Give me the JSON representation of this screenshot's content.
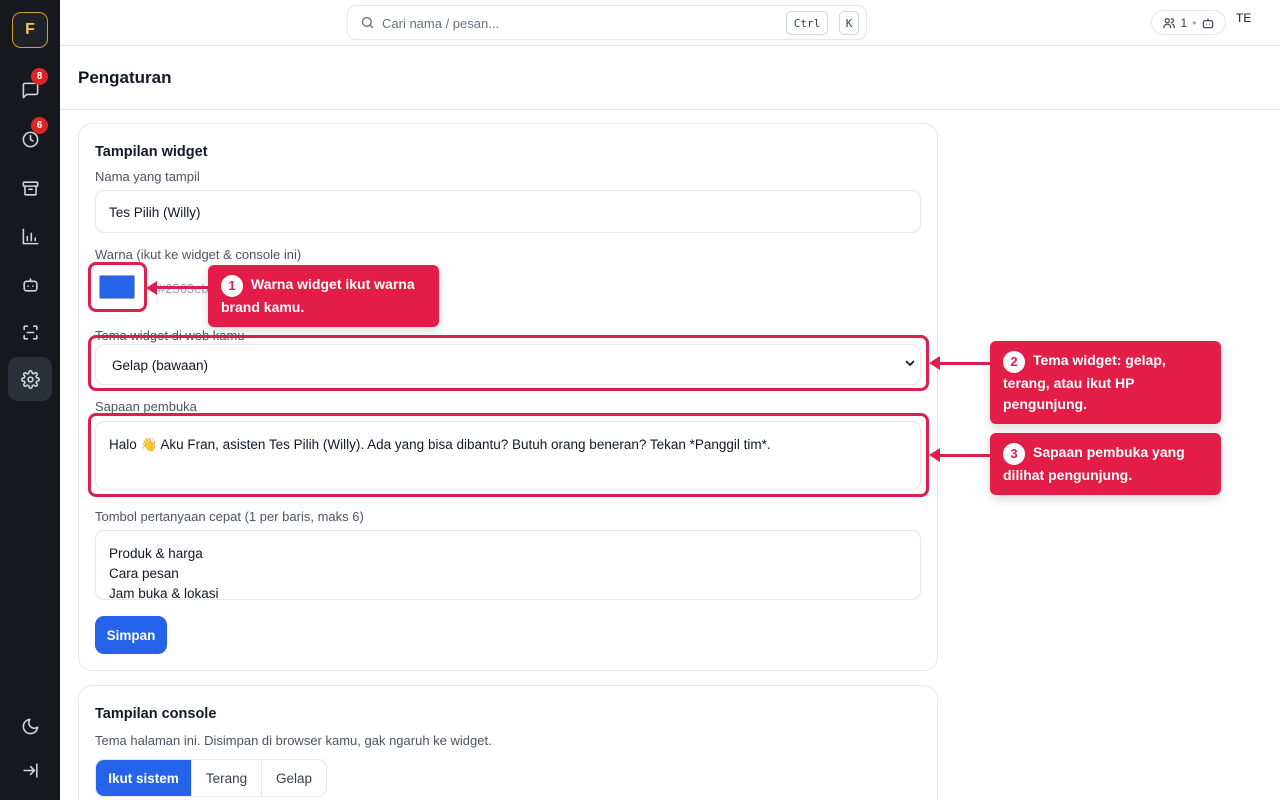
{
  "app": {
    "logo_letter": "F"
  },
  "sidebar": {
    "items": [
      {
        "name": "chat",
        "badge": "8"
      },
      {
        "name": "history",
        "badge": "6"
      },
      {
        "name": "archive",
        "badge": null
      },
      {
        "name": "analytics",
        "badge": null
      },
      {
        "name": "bot",
        "badge": null
      },
      {
        "name": "scan",
        "badge": null
      },
      {
        "name": "settings",
        "badge": null,
        "active": true
      }
    ]
  },
  "topbar": {
    "search_placeholder": "Cari nama / pesan...",
    "kbd_ctrl": "Ctrl",
    "kbd_k": "K",
    "online_count": "1",
    "user_initials": "TE"
  },
  "page": {
    "title": "Pengaturan"
  },
  "widget_card": {
    "title": "Tampilan widget",
    "name_label": "Nama yang tampil",
    "name_value": "Tes Pilih (Willy)",
    "color_label": "Warna (ikut ke widget & console ini)",
    "color_value": "#2563eb",
    "color_hex_text": "#2563eb",
    "theme_label": "Tema widget di web kamu",
    "theme_value": "Gelap (bawaan)",
    "greeting_label": "Sapaan pembuka",
    "greeting_value": "Halo 👋 Aku Fran, asisten Tes Pilih (Willy). Ada yang bisa dibantu? Butuh orang beneran? Tekan *Panggil tim*.",
    "quick_label": "Tombol pertanyaan cepat (1 per baris, maks 6)",
    "quick_lines": [
      "Produk & harga",
      "Cara pesan",
      "Jam buka & lokasi"
    ],
    "save_label": "Simpan"
  },
  "console_card": {
    "title": "Tampilan console",
    "description": "Tema halaman ini. Disimpan di browser kamu, gak ngaruh ke widget.",
    "options": [
      "Ikut sistem",
      "Terang",
      "Gelap"
    ],
    "selected": "Ikut sistem"
  },
  "callouts": [
    {
      "num": "1",
      "text": "Warna widget ikut warna brand kamu."
    },
    {
      "num": "2",
      "text": "Tema widget: gelap, terang, atau ikut HP pengunjung."
    },
    {
      "num": "3",
      "text": "Sapaan pembuka yang dilihat pengunjung."
    }
  ],
  "colors": {
    "accent": "#2563eb",
    "annotation": "#e11d48",
    "sidebar_bg": "#16181d"
  }
}
